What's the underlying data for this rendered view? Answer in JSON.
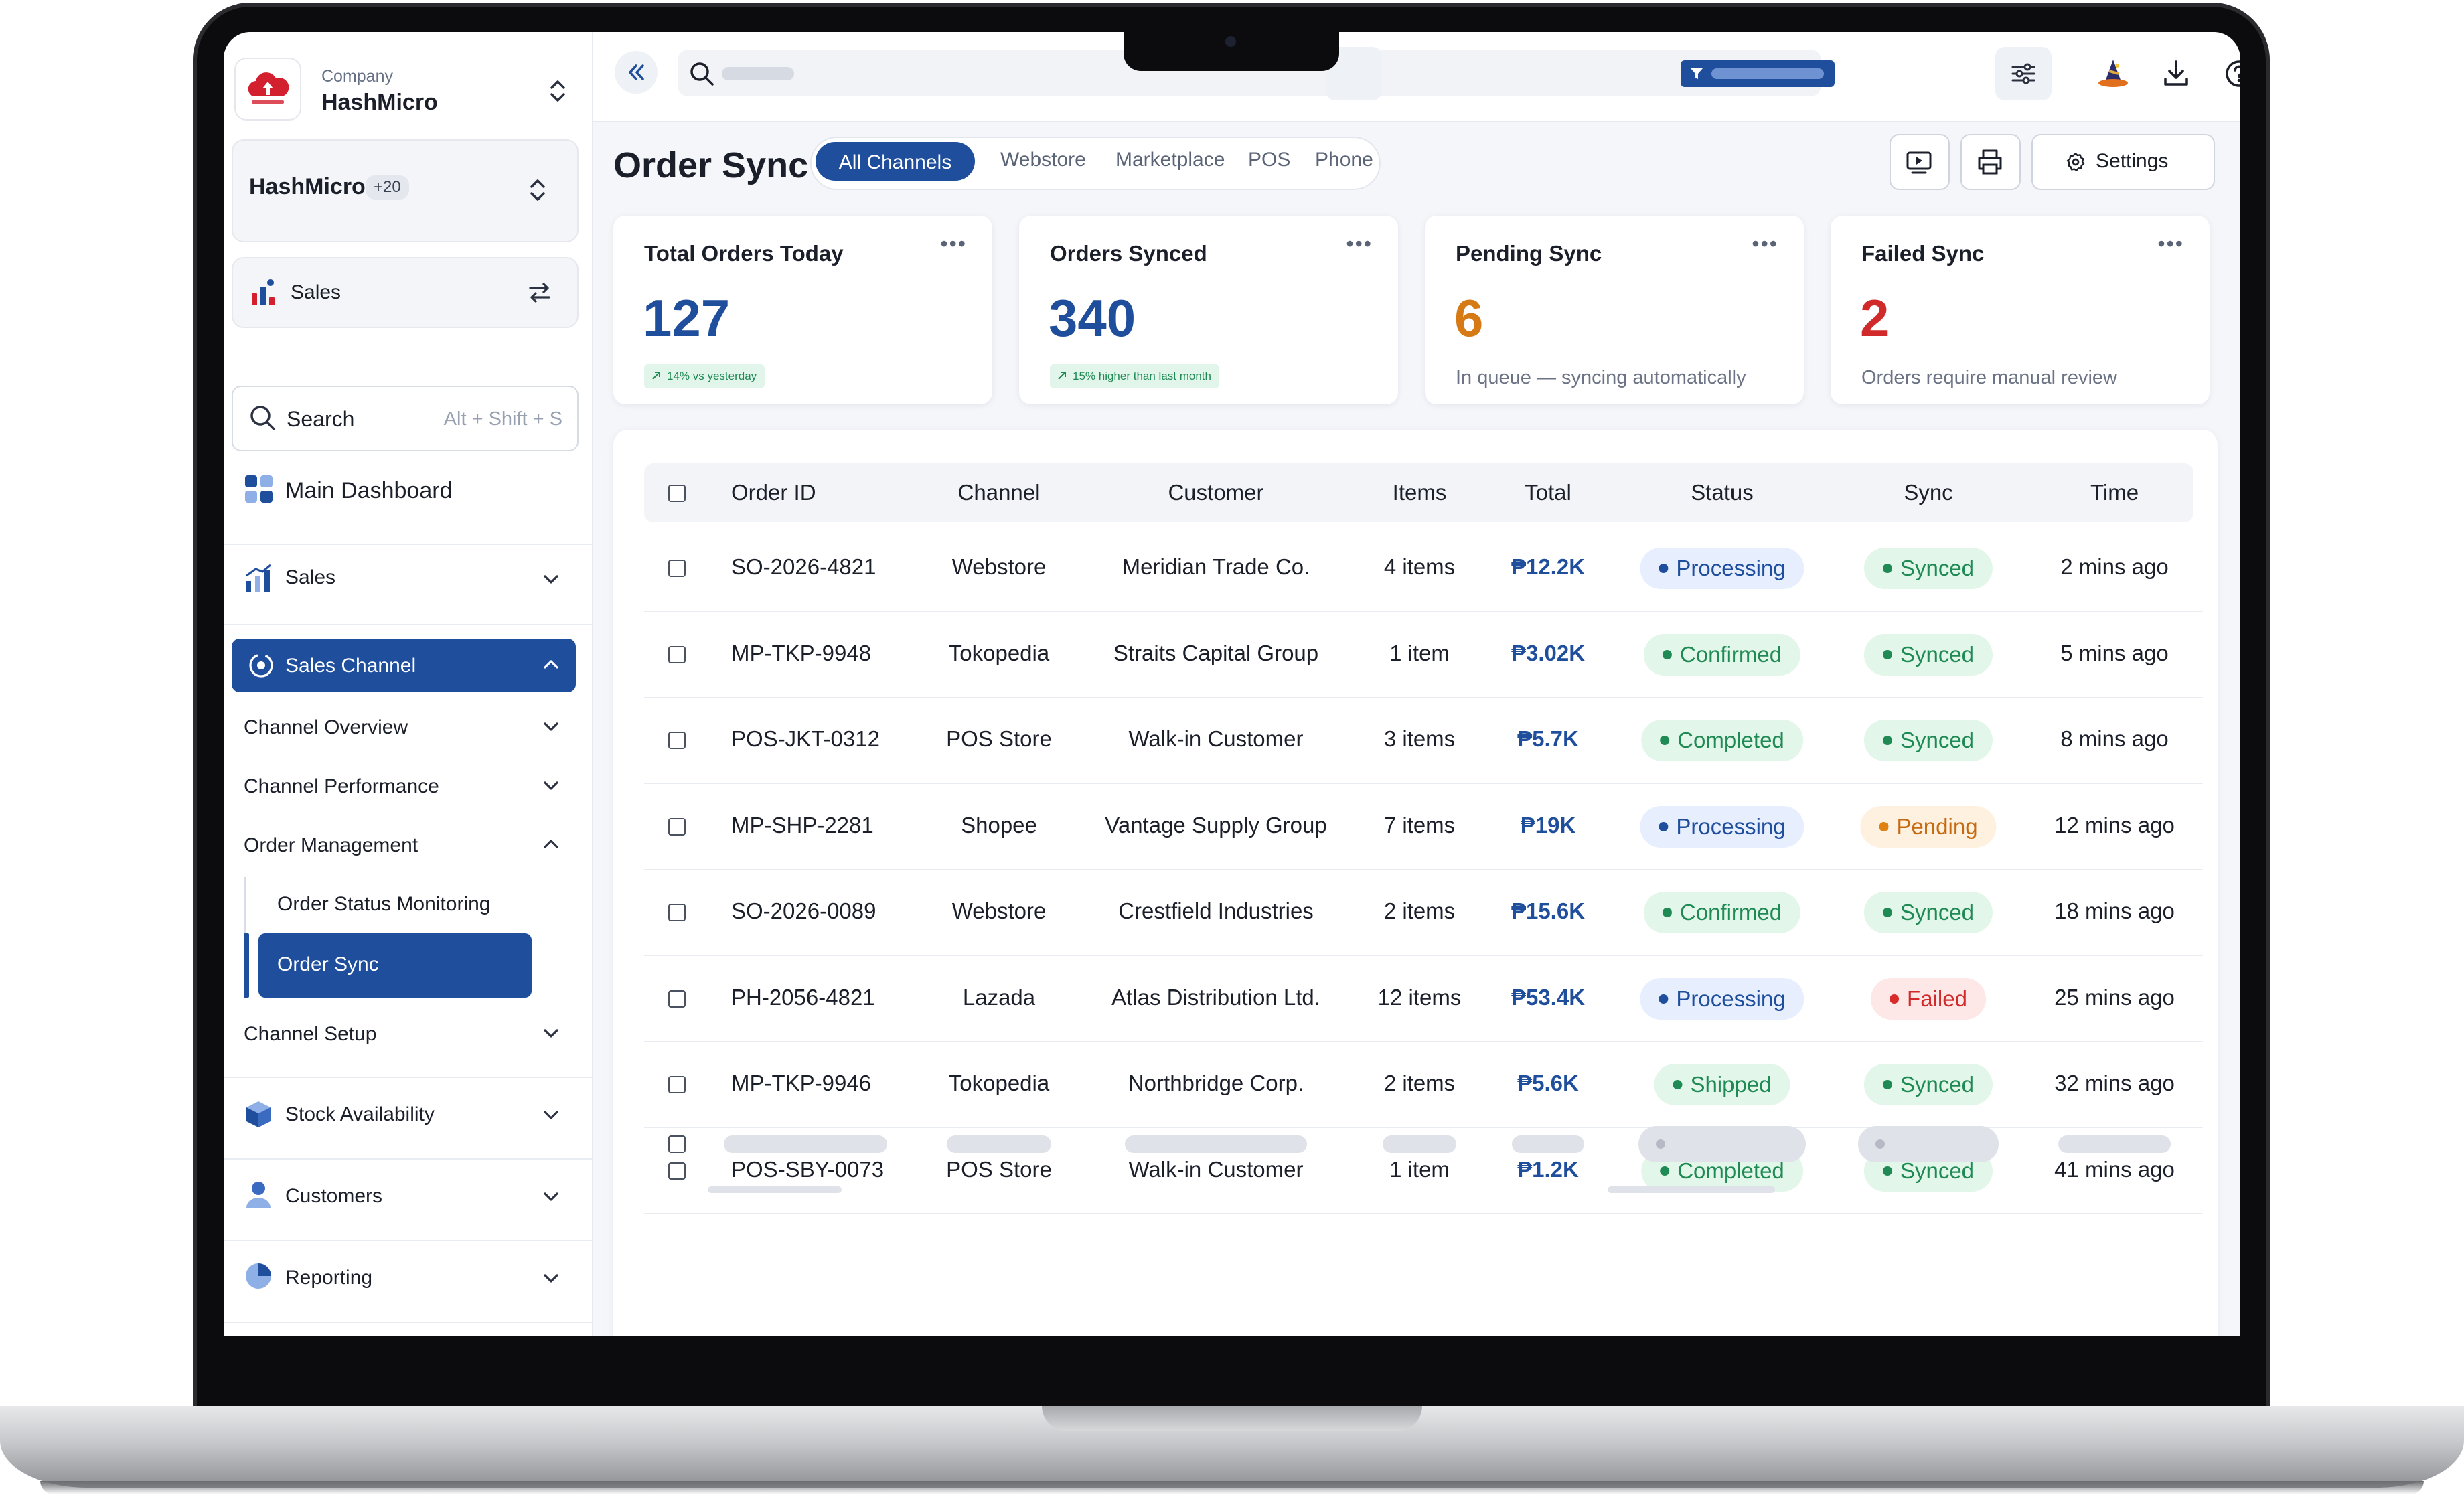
{
  "company": {
    "label": "Company",
    "name": "HashMicro"
  },
  "workspace": {
    "name": "HashMicro",
    "badge": "+20"
  },
  "module": {
    "name": "Sales"
  },
  "sidebar_search": {
    "label": "Search",
    "shortcut": "Alt + Shift + S"
  },
  "nav": {
    "main_dashboard": "Main Dashboard",
    "sales": "Sales",
    "sales_channel": "Sales Channel",
    "channel_overview": "Channel Overview",
    "channel_performance": "Channel Performance",
    "order_management": "Order Management",
    "order_status_monitoring": "Order Status Monitoring",
    "order_sync": "Order Sync",
    "channel_setup": "Channel Setup",
    "stock_availability": "Stock Availability",
    "customers": "Customers",
    "reporting": "Reporting"
  },
  "header": {
    "title": "Order Sync",
    "tabs": [
      "All Channels",
      "Webstore",
      "Marketplace",
      "POS",
      "Phone"
    ],
    "settings_label": "Settings"
  },
  "stats": [
    {
      "title": "Total Orders Today",
      "value": "127",
      "trend": "14% vs yesterday",
      "color": "#1f4e9c"
    },
    {
      "title": "Orders Synced",
      "value": "340",
      "trend": "15% higher than last month",
      "color": "#1f4e9c"
    },
    {
      "title": "Pending Sync",
      "value": "6",
      "note": "In queue — syncing automatically",
      "color": "#d67a16"
    },
    {
      "title": "Failed Sync",
      "value": "2",
      "note": "Orders require manual review",
      "color": "#d12a2a"
    }
  ],
  "table": {
    "columns": [
      "Order ID",
      "Channel",
      "Customer",
      "Items",
      "Total",
      "Status",
      "Sync",
      "Time"
    ],
    "rows": [
      {
        "id": "SO-2026-4821",
        "channel": "Webstore",
        "customer": "Meridian Trade Co.",
        "items": "4 items",
        "total": "₱12.2K",
        "status": "Processing",
        "sync": "Synced",
        "time": "2 mins  ago"
      },
      {
        "id": "MP-TKP-9948",
        "channel": "Tokopedia",
        "customer": "Straits Capital Group",
        "items": "1 item",
        "total": "₱3.02K",
        "status": "Confirmed",
        "sync": "Synced",
        "time": "5 mins ago"
      },
      {
        "id": "POS-JKT-0312",
        "channel": "POS Store",
        "customer": "Walk-in Customer",
        "items": "3 items",
        "total": "₱5.7K",
        "status": "Completed",
        "sync": "Synced",
        "time": "8 mins ago"
      },
      {
        "id": "MP-SHP-2281",
        "channel": "Shopee",
        "customer": "Vantage Supply Group",
        "items": "7 items",
        "total": "₱19K",
        "status": "Processing",
        "sync": "Pending",
        "time": "12 mins ago"
      },
      {
        "id": "SO-2026-0089",
        "channel": "Webstore",
        "customer": "Crestfield Industries",
        "items": "2 items",
        "total": "₱15.6K",
        "status": "Confirmed",
        "sync": "Synced",
        "time": "18 mins ago"
      },
      {
        "id": "PH-2056-4821",
        "channel": "Lazada",
        "customer": "Atlas Distribution Ltd.",
        "items": "12 items",
        "total": "₱53.4K",
        "status": "Processing",
        "sync": "Failed",
        "time": "25 mins ago"
      },
      {
        "id": "MP-TKP-9946",
        "channel": "Tokopedia",
        "customer": "Northbridge Corp.",
        "items": "2 items",
        "total": "₱5.6K",
        "status": "Shipped",
        "sync": "Synced",
        "time": "32 mins ago"
      },
      {
        "id": "POS-SBY-0073",
        "channel": "POS Store",
        "customer": "Walk-in Customer",
        "items": "1 item",
        "total": "₱1.2K",
        "status": "Completed",
        "sync": "Synced",
        "time": "41 mins ago"
      }
    ]
  },
  "colors": {
    "primary": "#1f4e9c",
    "success": "#1f8a54",
    "warning": "#d67a16",
    "danger": "#d12a2a",
    "brand_red": "#d3202f"
  }
}
